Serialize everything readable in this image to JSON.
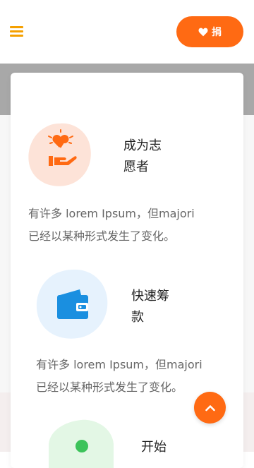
{
  "header": {
    "menu_icon": "hamburger-menu-icon",
    "donate_label": "捐",
    "donate_icon": "heart-icon"
  },
  "features": [
    {
      "icon": "heart-hand-icon",
      "title": "成为志愿者",
      "description_line1": "有许多 lorem Ipsum，但majori",
      "description_line2": "已经以某种形式发生了变化。"
    },
    {
      "icon": "wallet-icon",
      "title": "快速筹款",
      "description_line1": "有许多 lorem Ipsum，但majori",
      "description_line2": "已经以某种形式发生了变化。"
    },
    {
      "icon": "user-icon",
      "title": "开始"
    }
  ],
  "scroll_top": {
    "icon": "chevron-up-icon"
  },
  "colors": {
    "accent": "#ff6a13",
    "menu": "#f5a000",
    "blue": "#1a8fe0",
    "green": "#3cc35a"
  }
}
